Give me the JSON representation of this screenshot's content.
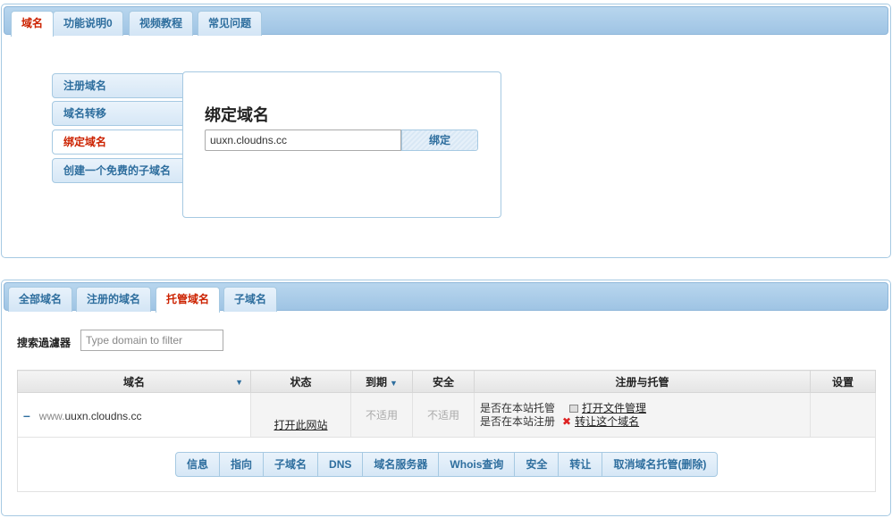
{
  "top_tabs": [
    "域名",
    "功能说明0",
    "视频教程",
    "常见问题"
  ],
  "side_menu": [
    "注册域名",
    "域名转移",
    "绑定域名",
    "创建一个免费的子域名"
  ],
  "bind": {
    "title": "绑定域名",
    "input_value": "uuxn.cloudns.cc",
    "button_label": "绑定"
  },
  "bottom_tabs": [
    "全部域名",
    "注册的域名",
    "托管域名",
    "子域名"
  ],
  "filter": {
    "label": "搜索過濾器",
    "placeholder": "Type domain to filter"
  },
  "table": {
    "headers": [
      "域名",
      "状态",
      "到期",
      "安全",
      "注册与托管",
      "设置"
    ],
    "row": {
      "domain_prefix": "www.",
      "domain_name": "uuxn.cloudns.cc",
      "status_link": "打开此网站",
      "expiry": "不适用",
      "security": "不适用",
      "hosted_label": "是否在本站托管",
      "hosted_link": "打开文件管理",
      "registered_label": "是否在本站注册",
      "registered_link": "转让这个域名"
    },
    "actions": [
      "信息",
      "指向",
      "子域名",
      "DNS",
      "域名服务器",
      "Whois查询",
      "安全",
      "转让",
      "取消域名托管(删除)"
    ]
  },
  "colors": {
    "accent": "#2e6e9e",
    "active_tab_text": "#cc2200",
    "border": "#a6c9e2"
  },
  "icons": [
    "sort-arrow-icon",
    "collapse-icon",
    "file-manager-icon",
    "close-x-icon"
  ]
}
